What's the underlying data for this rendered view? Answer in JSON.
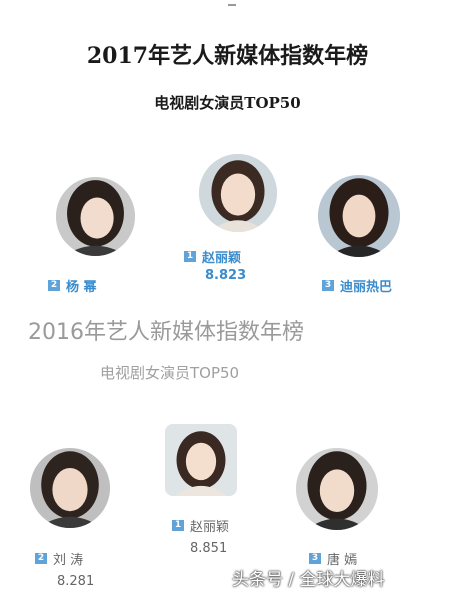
{
  "header_2017": {
    "title": "2017年艺人新媒体指数年榜",
    "subtitle": "电视剧女演员TOP50"
  },
  "ranking_2017": [
    {
      "rank": "1",
      "name": "赵丽颖",
      "score": "8.823"
    },
    {
      "rank": "2",
      "name": "杨 幂"
    },
    {
      "rank": "3",
      "name": "迪丽热巴"
    }
  ],
  "header_2016": {
    "title": "2016年艺人新媒体指数年榜",
    "subtitle": "电视剧女演员TOP50"
  },
  "ranking_2016": [
    {
      "rank": "1",
      "name": "赵丽颖",
      "score": "8.851"
    },
    {
      "rank": "2",
      "name": "刘 涛",
      "score": "8.281"
    },
    {
      "rank": "3",
      "name": "唐 嫣"
    }
  ],
  "watermark": "头条号 / 全球大爆料",
  "colors": {
    "accent": "#3a8ccd",
    "badge": "#5fa3d9",
    "faded": "#9a9a9a"
  }
}
